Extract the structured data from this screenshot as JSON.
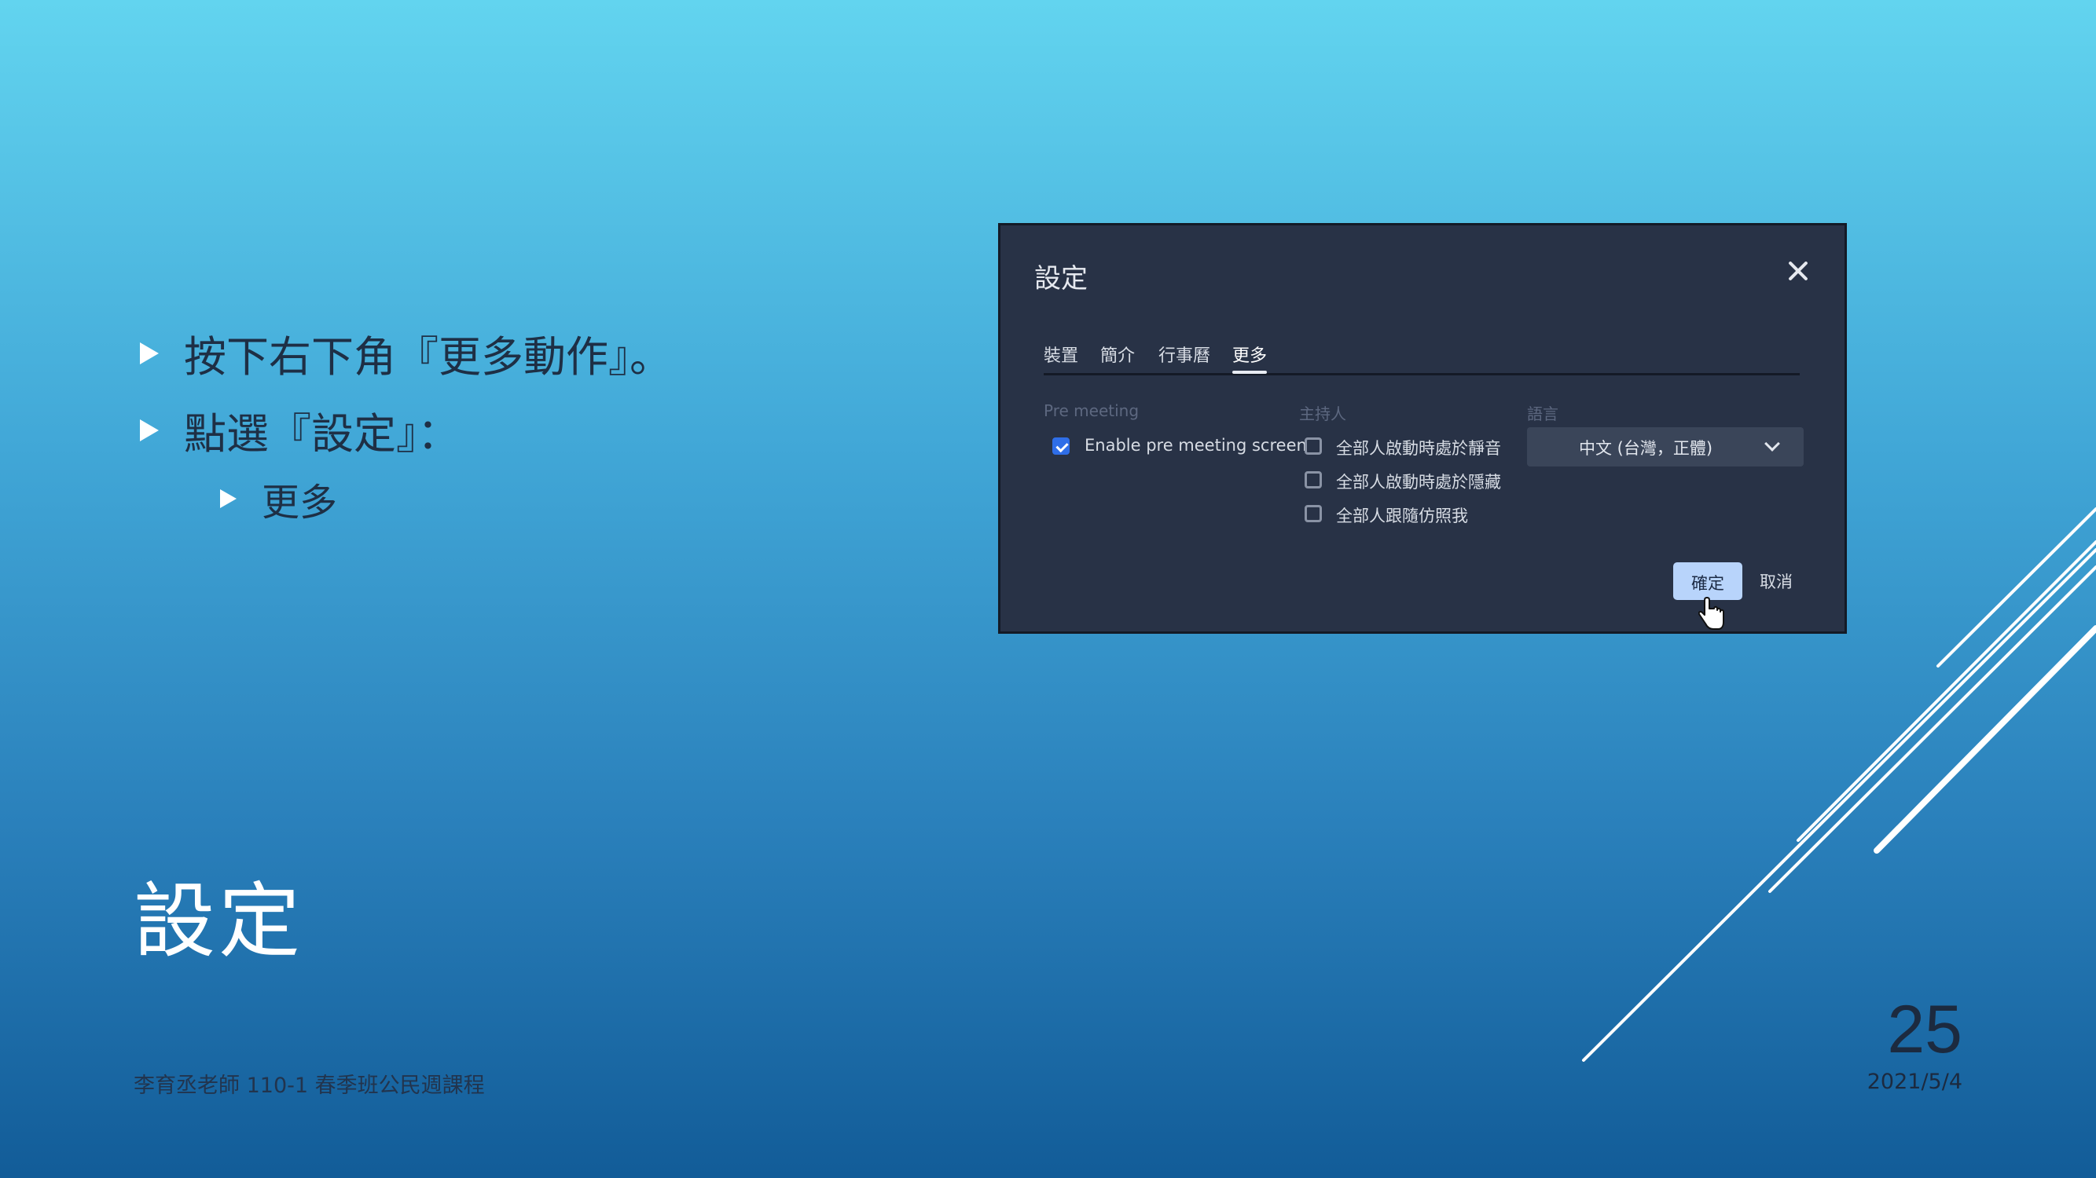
{
  "bullets": {
    "item1": "按下右下角『更多動作』。",
    "item2": "點選『設定』：",
    "item3": "更多"
  },
  "slide_title": "設定",
  "footer": "李育丞老師 110-1 春季班公民週課程",
  "page_number": "25",
  "date": "2021/5/4",
  "dialog": {
    "title": "設定",
    "close_icon": "close-icon",
    "tabs": [
      {
        "label": "裝置",
        "active": false
      },
      {
        "label": "簡介",
        "active": false
      },
      {
        "label": "行事曆",
        "active": false
      },
      {
        "label": "更多",
        "active": true
      }
    ],
    "pre_meeting": {
      "header": "Pre meeting",
      "option": {
        "label": "Enable pre meeting screen",
        "checked": true
      }
    },
    "host": {
      "header": "主持人",
      "options": [
        {
          "label": "全部人啟動時處於靜音",
          "checked": false
        },
        {
          "label": "全部人啟動時處於隱藏",
          "checked": false
        },
        {
          "label": "全部人跟隨仿照我",
          "checked": false
        }
      ]
    },
    "language": {
      "header": "語言",
      "value": "中文 (台灣，正體)"
    },
    "ok_label": "確定",
    "cancel_label": "取消"
  },
  "colors": {
    "dialog_bg": "#283246",
    "accent_blue": "#2f6ee8",
    "ok_button": "#b8d4fb"
  }
}
